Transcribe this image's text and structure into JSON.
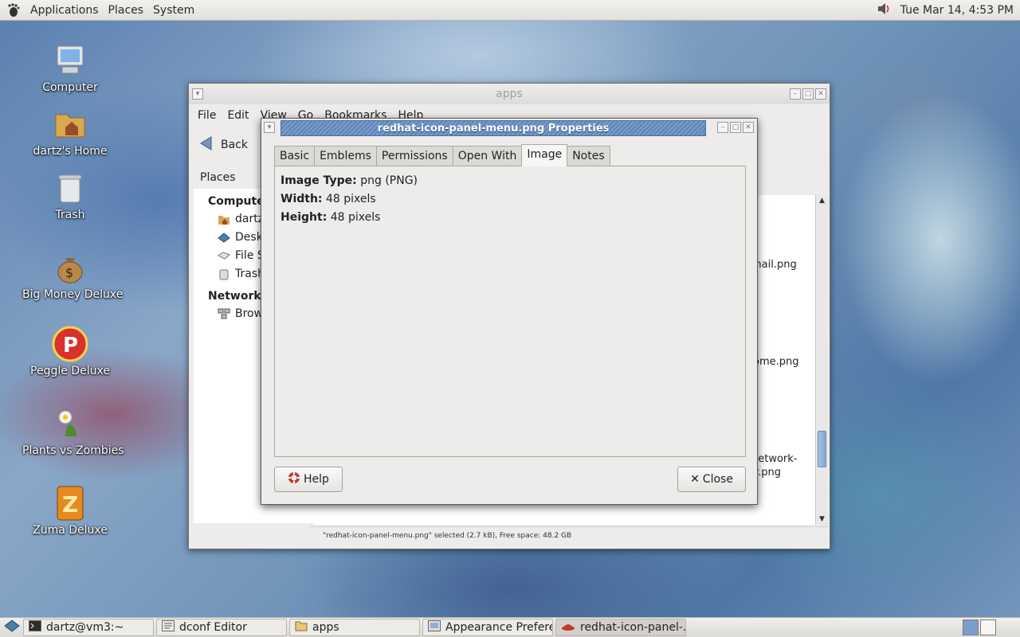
{
  "top_panel": {
    "menus": [
      "Applications",
      "Places",
      "System"
    ],
    "clock": "Tue Mar 14,  4:53 PM"
  },
  "desktop_icons": [
    {
      "label": "Computer",
      "icon": "computer-icon"
    },
    {
      "label": "dartz's Home",
      "icon": "home-folder-icon"
    },
    {
      "label": "Trash",
      "icon": "trash-icon"
    },
    {
      "label": "Big Money Deluxe",
      "icon": "money-bag-icon"
    },
    {
      "label": "Peggle Deluxe",
      "icon": "peggle-icon"
    },
    {
      "label": "Plants vs Zombies",
      "icon": "plants-icon"
    },
    {
      "label": "Zuma Deluxe",
      "icon": "zuma-icon"
    }
  ],
  "file_manager": {
    "title": "apps",
    "menus": [
      "File",
      "Edit",
      "View",
      "Go",
      "Bookmarks",
      "Help"
    ],
    "back_label": "Back",
    "places_label": "Places",
    "sidebar": {
      "computer_head": "Computer",
      "computer_items": [
        "dartz",
        "Desktop",
        "File System",
        "Trash"
      ],
      "network_head": "Network",
      "network_items": [
        "Browse Network"
      ]
    },
    "files_visible": [
      "mail.png",
      "ome.png",
      "network-",
      "r.png"
    ],
    "status": "\"redhat-icon-panel-menu.png\" selected (2.7 kB), Free space: 48.2 GB"
  },
  "dialog": {
    "title": "redhat-icon-panel-menu.png Properties",
    "tabs": [
      "Basic",
      "Emblems",
      "Permissions",
      "Open With",
      "Image",
      "Notes"
    ],
    "active_tab": "Image",
    "props": {
      "image_type_label": "Image Type:",
      "image_type_value": "png (PNG)",
      "width_label": "Width:",
      "width_value": "48 pixels",
      "height_label": "Height:",
      "height_value": "48 pixels"
    },
    "help_label": "Help",
    "close_label": "Close"
  },
  "taskbar": {
    "tasks": [
      {
        "label": "dartz@vm3:~",
        "icon": "terminal-icon"
      },
      {
        "label": "dconf Editor",
        "icon": "dconf-icon"
      },
      {
        "label": "apps",
        "icon": "folder-icon"
      },
      {
        "label": "Appearance Prefere...",
        "icon": "appearance-icon"
      },
      {
        "label": "redhat-icon-panel-...",
        "icon": "redhat-icon"
      }
    ]
  },
  "colors": {
    "dialog_title": "#6a8fc2",
    "workspace_active": "#7a9dcc"
  }
}
